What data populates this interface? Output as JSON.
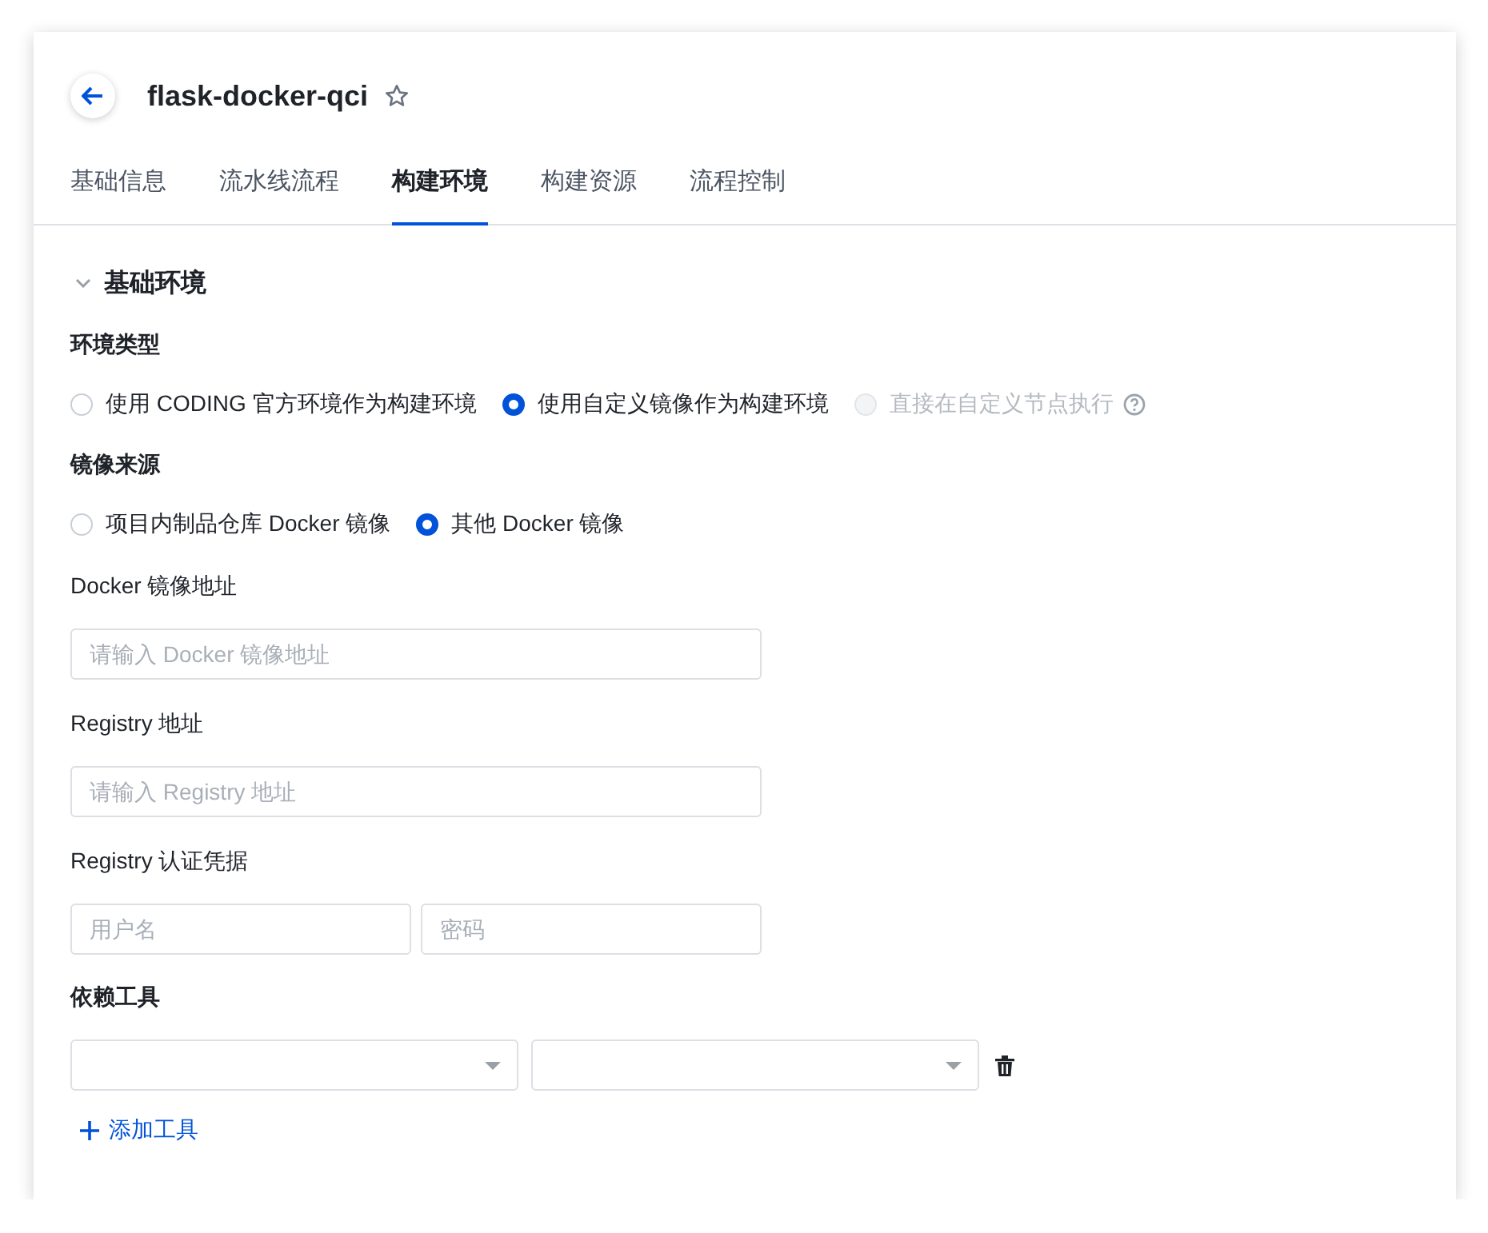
{
  "header": {
    "title": "flask-docker-qci",
    "starred": false
  },
  "tabs": [
    {
      "label": "基础信息",
      "selected": false
    },
    {
      "label": "流水线流程",
      "selected": false
    },
    {
      "label": "构建环境",
      "selected": true
    },
    {
      "label": "构建资源",
      "selected": false
    },
    {
      "label": "流程控制",
      "selected": false
    }
  ],
  "section": {
    "title": "基础环境",
    "expanded": true
  },
  "form": [
    {
      "kind": "radio",
      "label": "环境类型",
      "options": [
        {
          "label": "使用 CODING 官方环境作为构建环境",
          "selected": false,
          "disabled": false,
          "help": false
        },
        {
          "label": "使用自定义镜像作为构建环境",
          "selected": true,
          "disabled": false,
          "help": false
        },
        {
          "label": "直接在自定义节点执行",
          "selected": false,
          "disabled": true,
          "help": true
        }
      ]
    },
    {
      "kind": "radio",
      "label": "镜像来源",
      "options": [
        {
          "label": "项目内制品仓库 Docker 镜像",
          "selected": false,
          "disabled": false,
          "help": false
        },
        {
          "label": "其他 Docker 镜像",
          "selected": true,
          "disabled": false,
          "help": false
        }
      ]
    },
    {
      "kind": "inputs",
      "label": "Docker 镜像地址",
      "inputs": [
        {
          "placeholder": "请输入 Docker 镜像地址"
        }
      ]
    },
    {
      "kind": "inputs",
      "label": "Registry 地址",
      "inputs": [
        {
          "placeholder": "请输入 Registry 地址"
        }
      ]
    },
    {
      "kind": "inputs",
      "label": "Registry 认证凭据",
      "inputs": [
        {
          "placeholder": "用户名"
        },
        {
          "placeholder": "密码"
        }
      ]
    },
    {
      "kind": "tools",
      "label": "依赖工具",
      "rows": [
        {
          "selects": [
            {
              "kind": "select"
            },
            {
              "kind": "select"
            }
          ]
        }
      ],
      "add_label": "添加工具"
    }
  ]
}
